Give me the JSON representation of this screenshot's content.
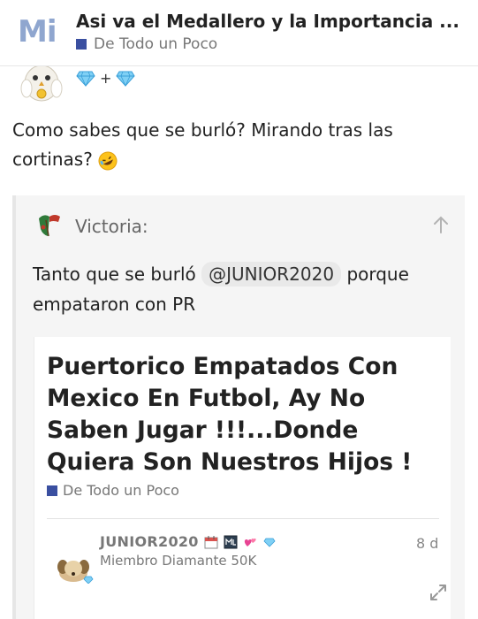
{
  "header": {
    "logo": "Mi",
    "title": "Asi va el Medallero y la Importancia ...",
    "category": "De Todo un Poco",
    "category_color": "#3a4fa0"
  },
  "post": {
    "flair_plus": "+",
    "text": "Como sabes que se burló? Mirando tras las cortinas?"
  },
  "quote": {
    "username": "Victoria:",
    "text_before": "Tanto que se burló",
    "mention": "@JUNIOR2020",
    "text_after": "porque empataron con PR"
  },
  "onebox": {
    "title": "Puertorico Empatados Con Mexico En Futbol, Ay No Saben Jugar !!!...Donde Quiera Son Nuestros Hijos !",
    "category": "De Todo un Poco",
    "author": "JUNIOR2020",
    "author_subtitle": "Miembro Diamante 50K",
    "date": "8 d"
  }
}
